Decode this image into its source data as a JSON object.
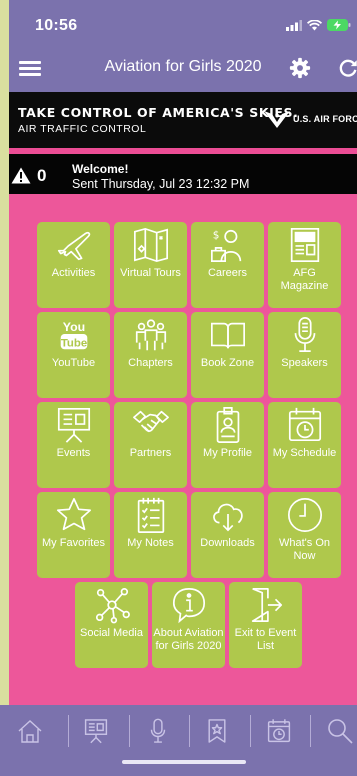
{
  "status_bar": {
    "time": "10:56",
    "icons": [
      "signal-icon",
      "wifi-icon",
      "battery-charging-icon"
    ]
  },
  "nav": {
    "title": "Aviation for Girls 2020",
    "icons": [
      "menu-icon",
      "gear-icon",
      "refresh-icon"
    ]
  },
  "banner": {
    "title": "TAKE CONTROL OF AMERICA'S SKIES.",
    "subtitle": "AIR TRAFFIC CONTROL",
    "logo_text": "U.S. AIR FORCE"
  },
  "alert": {
    "count": "0",
    "title": "Welcome!",
    "message": "Sent Thursday, Jul 23 12:32 PM"
  },
  "tiles": [
    {
      "label": "Activities",
      "icon": "airplane-icon"
    },
    {
      "label": "Virtual Tours",
      "icon": "map-icon"
    },
    {
      "label": "Careers",
      "icon": "career-person-icon"
    },
    {
      "label": "AFG Magazine",
      "icon": "magazine-icon"
    },
    {
      "label": "YouTube",
      "icon": "youtube-icon",
      "icon_text": [
        "You",
        "Tube"
      ]
    },
    {
      "label": "Chapters",
      "icon": "group-icon"
    },
    {
      "label": "Book Zone",
      "icon": "open-book-icon"
    },
    {
      "label": "Speakers",
      "icon": "microphone-icon"
    },
    {
      "label": "Events",
      "icon": "presentation-board-icon"
    },
    {
      "label": "Partners",
      "icon": "handshake-icon"
    },
    {
      "label": "My Profile",
      "icon": "id-badge-icon"
    },
    {
      "label": "My Schedule",
      "icon": "calendar-clock-icon"
    },
    {
      "label": "My Favorites",
      "icon": "star-icon"
    },
    {
      "label": "My Notes",
      "icon": "notes-checklist-icon"
    },
    {
      "label": "Downloads",
      "icon": "cloud-download-icon"
    },
    {
      "label": "What's On Now",
      "icon": "clock-icon"
    },
    {
      "label": "Social Media",
      "icon": "network-icon"
    },
    {
      "label": "About Aviation for Girls 2020",
      "icon": "info-icon"
    },
    {
      "label": "Exit to Event List",
      "icon": "exit-door-icon"
    }
  ],
  "tab_bar": [
    "home-icon",
    "presentation-board-icon",
    "microphone-icon",
    "bookmark-star-icon",
    "calendar-clock-icon",
    "search-icon"
  ],
  "colors": {
    "purple": "#7b72ad",
    "pink": "#ed579a",
    "tile_green": "#afc84c",
    "banner_black": "#0b0b0b",
    "left_strip": "#d9df9f"
  }
}
